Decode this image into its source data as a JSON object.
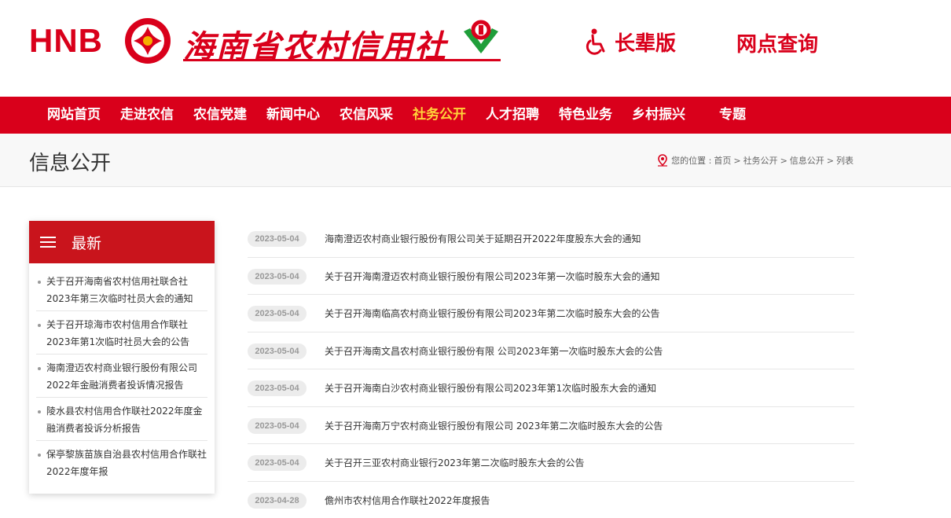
{
  "header": {
    "logo_hnb": "HNB",
    "logo_cn": "海南省农村信用社",
    "elder_label": "长辈版",
    "branch_label": "网点查询"
  },
  "nav": {
    "items": [
      {
        "label": "网站首页"
      },
      {
        "label": "走进农信"
      },
      {
        "label": "农信党建"
      },
      {
        "label": "新闻中心"
      },
      {
        "label": "农信风采"
      },
      {
        "label": "社务公开"
      },
      {
        "label": "人才招聘"
      },
      {
        "label": "特色业务"
      },
      {
        "label": "乡村振兴"
      },
      {
        "label": "专题"
      }
    ],
    "active_index": 5
  },
  "titlebar": {
    "title": "信息公开",
    "breadcrumb_prefix": "您的位置 :",
    "crumbs": [
      "首页",
      "社务公开",
      "信息公开",
      "列表"
    ],
    "separator": ">"
  },
  "sidebar": {
    "title": "最新",
    "items": [
      {
        "line1": "关于召开海南省农村信用社联合社",
        "line2": "2023年第三次临时社员大会的通知"
      },
      {
        "line1": "关于召开琼海市农村信用合作联社",
        "line2": "2023年第1次临时社员大会的公告"
      },
      {
        "line1": "海南澄迈农村商业银行股份有限公司",
        "line2": "2022年金融消费者投诉情况报告"
      },
      {
        "line1": "陵水县农村信用合作联社2022年度金",
        "line2": "融消费者投诉分析报告"
      },
      {
        "line1": "保亭黎族苗族自治县农村信用合作联社",
        "line2": "2022年度年报"
      }
    ]
  },
  "articles": [
    {
      "date": "2023-05-04",
      "title": "海南澄迈农村商业银行股份有限公司关于延期召开2022年度股东大会的通知"
    },
    {
      "date": "2023-05-04",
      "title": "关于召开海南澄迈农村商业银行股份有限公司2023年第一次临时股东大会的通知"
    },
    {
      "date": "2023-05-04",
      "title": "关于召开海南临高农村商业银行股份有限公司2023年第二次临时股东大会的公告"
    },
    {
      "date": "2023-05-04",
      "title": "关于召开海南文昌农村商业银行股份有限 公司2023年第一次临时股东大会的公告"
    },
    {
      "date": "2023-05-04",
      "title": "关于召开海南白沙农村商业银行股份有限公司2023年第1次临时股东大会的通知"
    },
    {
      "date": "2023-05-04",
      "title": "关于召开海南万宁农村商业银行股份有限公司 2023年第二次临时股东大会的公告"
    },
    {
      "date": "2023-05-04",
      "title": "关于召开三亚农村商业银行2023年第二次临时股东大会的公告"
    },
    {
      "date": "2023-04-28",
      "title": "儋州市农村信用合作联社2022年度报告"
    }
  ],
  "colors": {
    "brand_red": "#d9001b",
    "sidebar_head": "#c9141c",
    "nav_active": "#ffd33a",
    "logo_green": "#1f9e3a"
  }
}
